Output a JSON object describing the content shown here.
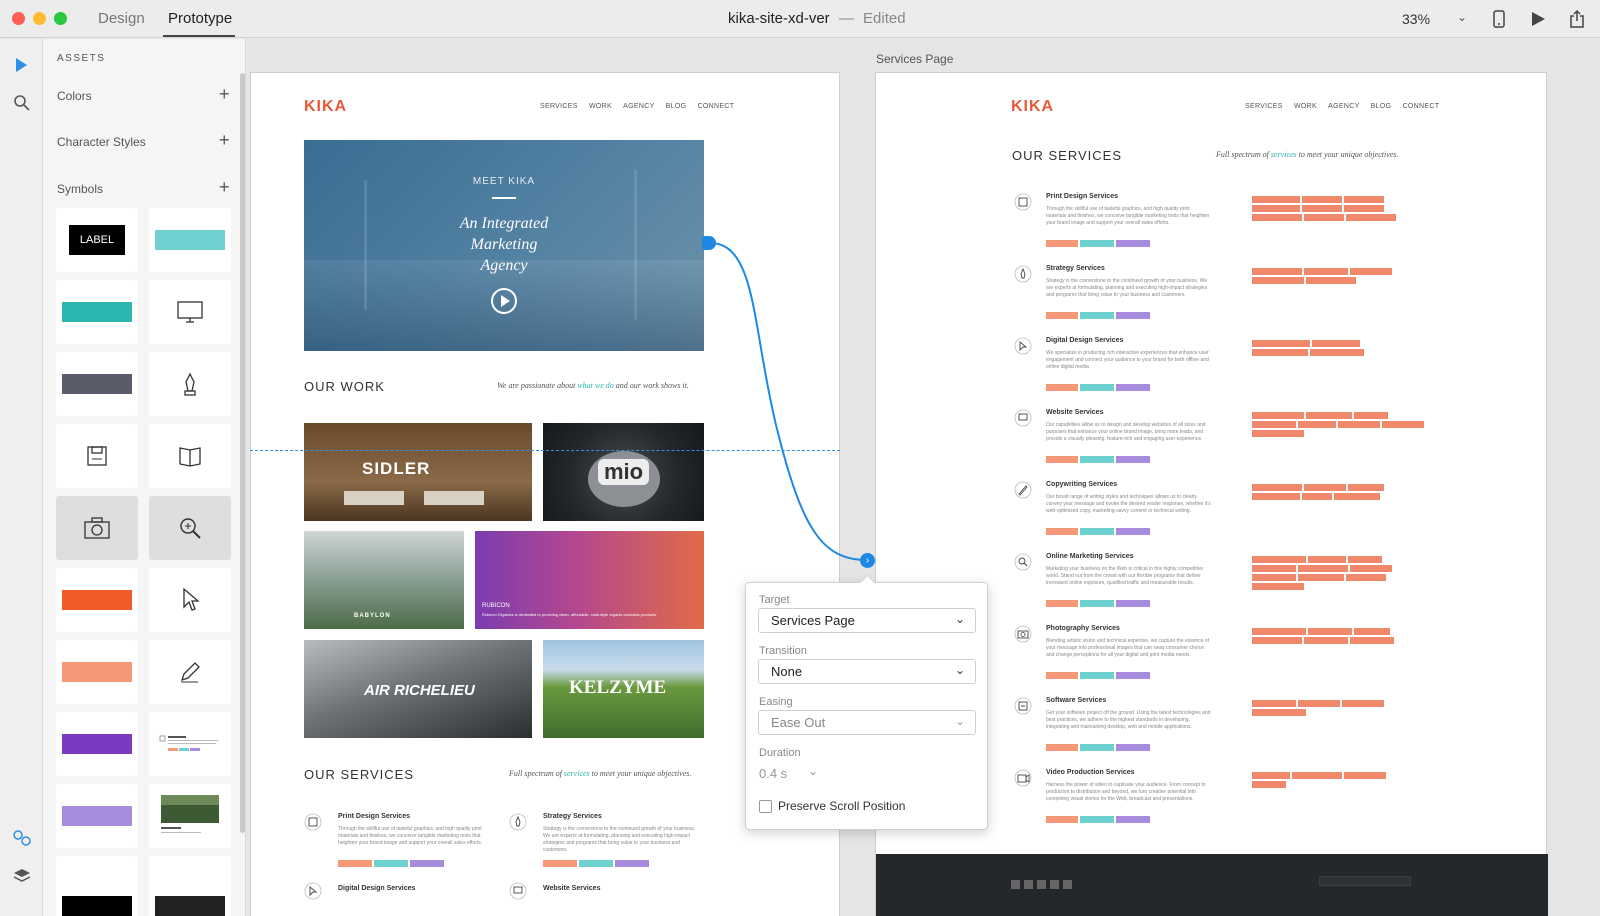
{
  "titlebar": {
    "tabs": [
      "Design",
      "Prototype"
    ],
    "active_tab": "Prototype",
    "doc_name": "kika-site-xd-ver",
    "separator": "—",
    "doc_status": "Edited",
    "zoom": "33%"
  },
  "assets": {
    "header": "ASSETS",
    "sections": [
      "Colors",
      "Character Styles",
      "Symbols"
    ],
    "label_symbol": "LABEL"
  },
  "artboards": {
    "services_name": "Services Page"
  },
  "site": {
    "logo": "KIKA",
    "nav": [
      "SERVICES",
      "WORK",
      "AGENCY",
      "BLOG",
      "CONNECT"
    ],
    "hero": {
      "kicker": "MEET KIKA",
      "line1": "An Integrated",
      "line2": "Marketing",
      "line3": "Agency"
    },
    "work": {
      "title": "OUR WORK",
      "tag_pre": "We are passionate about",
      "tag_link": "what we do",
      "tag_post": "and our work shows it."
    },
    "tiles": {
      "sidler": "SIDLER",
      "mio": "mio",
      "babylon": "BABYLON",
      "rubicon": "RUBICON",
      "rubicon_desc": "Rubicon Organics is dedicated to providing clean, affordable, craft-style organic cannabis products.",
      "air": "AIR RICHELIEU",
      "kelzyme": "KELZYME"
    },
    "services": {
      "title": "OUR SERVICES",
      "tag_pre": "Full spectrum of",
      "tag_link": "services",
      "tag_post": "to meet your unique objectives.",
      "items": [
        {
          "name": "Print Design Services",
          "body": "Through the skillful use of tasteful graphics, and high quality print materials and finishes, we conceive tangible marketing tools that heighten your brand image and support your overall sales efforts."
        },
        {
          "name": "Strategy Services",
          "body": "Strategy is the cornerstone to the continued growth of your business. We are experts at formulating, planning and executing high-impact strategies and programs that bring value to your business and customers."
        },
        {
          "name": "Digital Design Services",
          "body": "We specialize in producing rich interactive experiences that enhance user engagement and connect your audience to your brand for both offline and online digital media."
        },
        {
          "name": "Website Services",
          "body": "Our capabilities allow us to design and develop websites of all sizes and purposes that enhance your online brand image, bring more leads, and provide a visually pleasing, feature-rich and engaging user experience."
        },
        {
          "name": "Copywriting Services",
          "body": "Our broad range of writing styles and techniques allows us to clearly convey your message and evoke the desired reader response, whether it's web-optimized copy, marketing-savvy content or technical writing."
        },
        {
          "name": "Online Marketing Services",
          "body": "Marketing your business on the Web is critical in this highly competitive world. Stand out from the crowd with our flexible programs that deliver increased online exposure, qualified traffic and measurable results."
        },
        {
          "name": "Photography Services",
          "body": "Blending artistic vision and technical expertise, we capture the essence of your message into professional images that can sway consumer choice and change perceptions for all your digital and print media needs."
        },
        {
          "name": "Software Services",
          "body": "Get your software project off the ground. Using the latest technologies and best practices, we adhere to the highest standards in developing, integrating and maintaining desktop, web and mobile applications."
        },
        {
          "name": "Video Production Services",
          "body": "Harness the power of video to captivate your audience. From concept to production to distribution and beyond, we turn creative potential into competing visual stories for the Web, broadcast and presentations."
        }
      ]
    }
  },
  "popover": {
    "target_label": "Target",
    "target_value": "Services Page",
    "transition_label": "Transition",
    "transition_value": "None",
    "easing_label": "Easing",
    "easing_value": "Ease Out",
    "duration_label": "Duration",
    "duration_value": "0.4 s",
    "preserve_label": "Preserve Scroll Position",
    "preserve_checked": false
  },
  "colors": {
    "teal": "#2ab7b1",
    "light_teal": "#6fd1cf",
    "slate": "#595d6a",
    "orange": "#f15a29",
    "salmon": "#f59877",
    "purple": "#7b39c4",
    "lavender": "#a78bdc",
    "wire": "#1e88e5"
  }
}
